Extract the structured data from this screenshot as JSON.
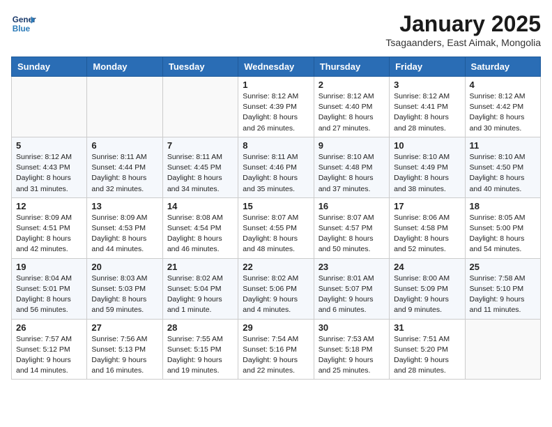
{
  "header": {
    "logo_line1": "General",
    "logo_line2": "Blue",
    "month": "January 2025",
    "location": "Tsagaanders, East Aimak, Mongolia"
  },
  "days_of_week": [
    "Sunday",
    "Monday",
    "Tuesday",
    "Wednesday",
    "Thursday",
    "Friday",
    "Saturday"
  ],
  "weeks": [
    [
      {
        "day": "",
        "info": ""
      },
      {
        "day": "",
        "info": ""
      },
      {
        "day": "",
        "info": ""
      },
      {
        "day": "1",
        "info": "Sunrise: 8:12 AM\nSunset: 4:39 PM\nDaylight: 8 hours and 26 minutes."
      },
      {
        "day": "2",
        "info": "Sunrise: 8:12 AM\nSunset: 4:40 PM\nDaylight: 8 hours and 27 minutes."
      },
      {
        "day": "3",
        "info": "Sunrise: 8:12 AM\nSunset: 4:41 PM\nDaylight: 8 hours and 28 minutes."
      },
      {
        "day": "4",
        "info": "Sunrise: 8:12 AM\nSunset: 4:42 PM\nDaylight: 8 hours and 30 minutes."
      }
    ],
    [
      {
        "day": "5",
        "info": "Sunrise: 8:12 AM\nSunset: 4:43 PM\nDaylight: 8 hours and 31 minutes."
      },
      {
        "day": "6",
        "info": "Sunrise: 8:11 AM\nSunset: 4:44 PM\nDaylight: 8 hours and 32 minutes."
      },
      {
        "day": "7",
        "info": "Sunrise: 8:11 AM\nSunset: 4:45 PM\nDaylight: 8 hours and 34 minutes."
      },
      {
        "day": "8",
        "info": "Sunrise: 8:11 AM\nSunset: 4:46 PM\nDaylight: 8 hours and 35 minutes."
      },
      {
        "day": "9",
        "info": "Sunrise: 8:10 AM\nSunset: 4:48 PM\nDaylight: 8 hours and 37 minutes."
      },
      {
        "day": "10",
        "info": "Sunrise: 8:10 AM\nSunset: 4:49 PM\nDaylight: 8 hours and 38 minutes."
      },
      {
        "day": "11",
        "info": "Sunrise: 8:10 AM\nSunset: 4:50 PM\nDaylight: 8 hours and 40 minutes."
      }
    ],
    [
      {
        "day": "12",
        "info": "Sunrise: 8:09 AM\nSunset: 4:51 PM\nDaylight: 8 hours and 42 minutes."
      },
      {
        "day": "13",
        "info": "Sunrise: 8:09 AM\nSunset: 4:53 PM\nDaylight: 8 hours and 44 minutes."
      },
      {
        "day": "14",
        "info": "Sunrise: 8:08 AM\nSunset: 4:54 PM\nDaylight: 8 hours and 46 minutes."
      },
      {
        "day": "15",
        "info": "Sunrise: 8:07 AM\nSunset: 4:55 PM\nDaylight: 8 hours and 48 minutes."
      },
      {
        "day": "16",
        "info": "Sunrise: 8:07 AM\nSunset: 4:57 PM\nDaylight: 8 hours and 50 minutes."
      },
      {
        "day": "17",
        "info": "Sunrise: 8:06 AM\nSunset: 4:58 PM\nDaylight: 8 hours and 52 minutes."
      },
      {
        "day": "18",
        "info": "Sunrise: 8:05 AM\nSunset: 5:00 PM\nDaylight: 8 hours and 54 minutes."
      }
    ],
    [
      {
        "day": "19",
        "info": "Sunrise: 8:04 AM\nSunset: 5:01 PM\nDaylight: 8 hours and 56 minutes."
      },
      {
        "day": "20",
        "info": "Sunrise: 8:03 AM\nSunset: 5:03 PM\nDaylight: 8 hours and 59 minutes."
      },
      {
        "day": "21",
        "info": "Sunrise: 8:02 AM\nSunset: 5:04 PM\nDaylight: 9 hours and 1 minute."
      },
      {
        "day": "22",
        "info": "Sunrise: 8:02 AM\nSunset: 5:06 PM\nDaylight: 9 hours and 4 minutes."
      },
      {
        "day": "23",
        "info": "Sunrise: 8:01 AM\nSunset: 5:07 PM\nDaylight: 9 hours and 6 minutes."
      },
      {
        "day": "24",
        "info": "Sunrise: 8:00 AM\nSunset: 5:09 PM\nDaylight: 9 hours and 9 minutes."
      },
      {
        "day": "25",
        "info": "Sunrise: 7:58 AM\nSunset: 5:10 PM\nDaylight: 9 hours and 11 minutes."
      }
    ],
    [
      {
        "day": "26",
        "info": "Sunrise: 7:57 AM\nSunset: 5:12 PM\nDaylight: 9 hours and 14 minutes."
      },
      {
        "day": "27",
        "info": "Sunrise: 7:56 AM\nSunset: 5:13 PM\nDaylight: 9 hours and 16 minutes."
      },
      {
        "day": "28",
        "info": "Sunrise: 7:55 AM\nSunset: 5:15 PM\nDaylight: 9 hours and 19 minutes."
      },
      {
        "day": "29",
        "info": "Sunrise: 7:54 AM\nSunset: 5:16 PM\nDaylight: 9 hours and 22 minutes."
      },
      {
        "day": "30",
        "info": "Sunrise: 7:53 AM\nSunset: 5:18 PM\nDaylight: 9 hours and 25 minutes."
      },
      {
        "day": "31",
        "info": "Sunrise: 7:51 AM\nSunset: 5:20 PM\nDaylight: 9 hours and 28 minutes."
      },
      {
        "day": "",
        "info": ""
      }
    ]
  ]
}
